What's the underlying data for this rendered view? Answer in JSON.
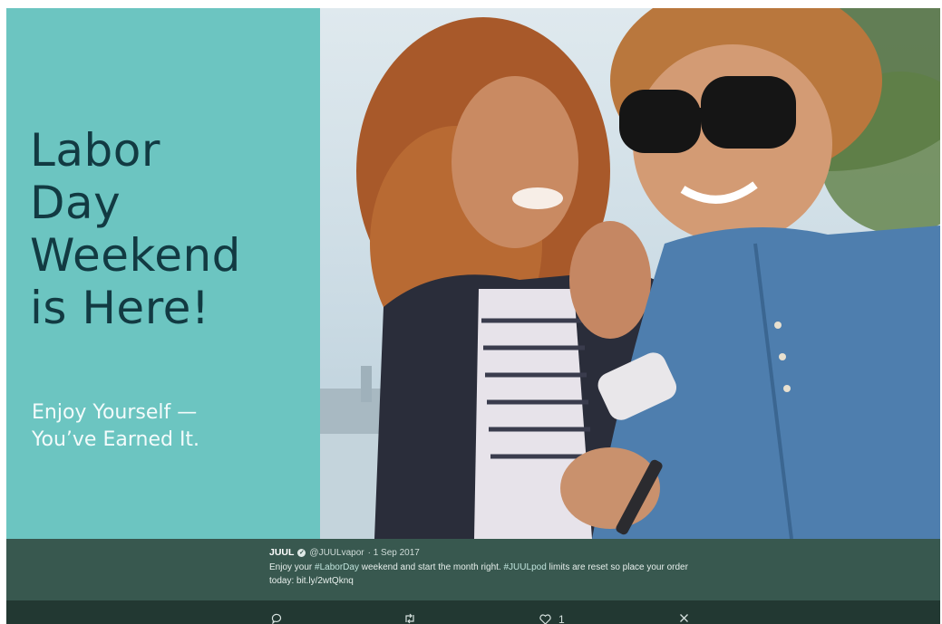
{
  "promo": {
    "headline_lines": [
      "Labor",
      "Day",
      "Weekend",
      "is Here!"
    ],
    "subline_lines": [
      "Enjoy Yourself —",
      "You’ve Earned It."
    ]
  },
  "tweet": {
    "author": "JUUL",
    "handle": "@JUULvapor",
    "date": "· 1 Sep 2017",
    "text_part1": "Enjoy your ",
    "hashtag1": "#LaborDay",
    "text_part2": " weekend and start the month right. ",
    "hashtag2": "#JUULpod",
    "text_part3": " limits are reset so place your order today: bit.ly/2wtQknq"
  },
  "actions": {
    "reply": "",
    "retweet": "",
    "like_count": "1",
    "close": ""
  },
  "colors": {
    "promo_bg": "#6cc5c1",
    "headline": "#123a42",
    "tweet_bar": "#38584f",
    "actions_bar": "#223832"
  },
  "icons": [
    "verified-icon",
    "reply-icon",
    "retweet-icon",
    "heart-icon",
    "close-icon"
  ]
}
